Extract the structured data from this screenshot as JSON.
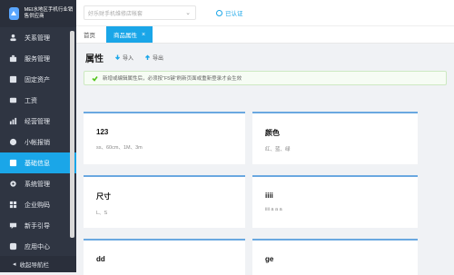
{
  "sidebar": {
    "brand": "MEI水地区手机行业销售供应商",
    "items": [
      {
        "label": "关系管理",
        "icon": "users-icon"
      },
      {
        "label": "服务管理",
        "icon": "briefcase-icon"
      },
      {
        "label": "固定资产",
        "icon": "box-icon"
      },
      {
        "label": "工资",
        "icon": "wallet-icon"
      },
      {
        "label": "经营管理",
        "icon": "chart-icon"
      },
      {
        "label": "小帐报销",
        "icon": "coin-icon"
      },
      {
        "label": "基础信息",
        "icon": "database-icon",
        "active": true
      },
      {
        "label": "系统管理",
        "icon": "gear-icon"
      },
      {
        "label": "企业购码",
        "icon": "grid-icon"
      },
      {
        "label": "新手引导",
        "icon": "guide-icon"
      },
      {
        "label": "应用中心",
        "icon": "apps-icon"
      }
    ],
    "collapse_label": "收起导航栏"
  },
  "topbar": {
    "shop_placeholder": "好乐财手机维修店帐套",
    "cert_label": "已认证"
  },
  "tabs": [
    {
      "label": "首页",
      "active": false
    },
    {
      "label": "商品属性",
      "active": true
    }
  ],
  "page": {
    "title": "属性",
    "import_label": "导入",
    "export_label": "导出",
    "notice": "新增或编辑属性后，必须按“F5键”刷新页面或重新登录才会生效"
  },
  "attributes": [
    {
      "name": "123",
      "values": "ss、60cm、1M、3m"
    },
    {
      "name": "颜色",
      "values": "红、蓝、绿"
    },
    {
      "name": "尺寸",
      "values": "L、S"
    },
    {
      "name": "iiii",
      "values": "iiii a a a"
    },
    {
      "name": "dd",
      "values": ""
    },
    {
      "name": "ge",
      "values": ""
    }
  ],
  "colors": {
    "sidebar_bg": "#2f3542",
    "accent": "#1aa6e8",
    "card_border": "#6aa8e0",
    "notice_bg": "#f6fcf4"
  }
}
